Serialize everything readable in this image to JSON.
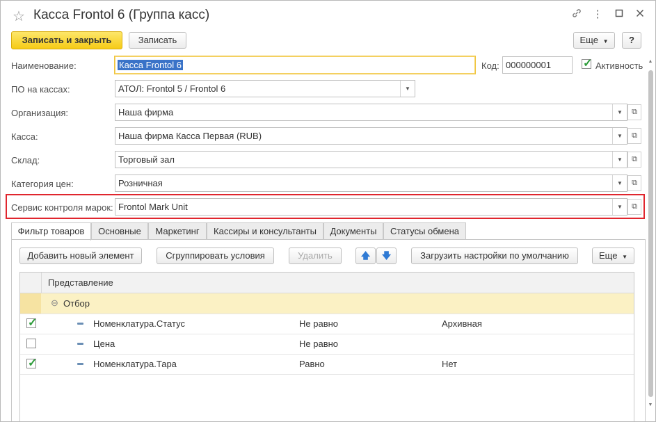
{
  "window": {
    "title": "Касса Frontol 6 (Группа касс)",
    "icons": [
      "star-icon",
      "link-icon",
      "more-vertical-icon",
      "minimize-icon",
      "maximize-icon",
      "close-icon"
    ]
  },
  "toolbar": {
    "save_close": "Записать и закрыть",
    "save": "Записать",
    "more": "Еще",
    "help": "?"
  },
  "form": {
    "name_label": "Наименование:",
    "name_value": "Касса Frontol 6",
    "code_label": "Код:",
    "code_value": "000000001",
    "active_label": "Активность",
    "active_checked": true,
    "software_label": "ПО на кассах:",
    "software_value": "АТОЛ: Frontol 5 / Frontol 6",
    "org_label": "Организация:",
    "org_value": "Наша фирма",
    "cash_label": "Касса:",
    "cash_value": "Наша фирма Касса Первая (RUB)",
    "warehouse_label": "Склад:",
    "warehouse_value": "Торговый зал",
    "price_label": "Категория цен:",
    "price_value": "Розничная",
    "mark_label": "Сервис контроля марок:",
    "mark_value": "Frontol Mark Unit"
  },
  "tabs": [
    {
      "label": "Фильтр товаров",
      "active": true
    },
    {
      "label": "Основные",
      "active": false
    },
    {
      "label": "Маркетинг",
      "active": false
    },
    {
      "label": "Кассиры и консультанты",
      "active": false
    },
    {
      "label": "Документы",
      "active": false
    },
    {
      "label": "Статусы обмена",
      "active": false
    }
  ],
  "filter_toolbar": {
    "add": "Добавить новый элемент",
    "group": "Сгруппировать условия",
    "delete": "Удалить",
    "load_defaults": "Загрузить настройки по умолчанию",
    "more": "Еще"
  },
  "grid": {
    "header": "Представление",
    "group_row": "Отбор",
    "rows": [
      {
        "checked": true,
        "field": "Номенклатура.Статус",
        "condition": "Не равно",
        "value": "Архивная"
      },
      {
        "checked": false,
        "field": "Цена",
        "condition": "Не равно",
        "value": ""
      },
      {
        "checked": true,
        "field": "Номенклатура.Тара",
        "condition": "Равно",
        "value": "Нет"
      }
    ]
  },
  "colors": {
    "accent": "#f6cb16",
    "highlight": "#e0262e",
    "selection": "#3a73c8",
    "check": "#2d9c3a"
  }
}
